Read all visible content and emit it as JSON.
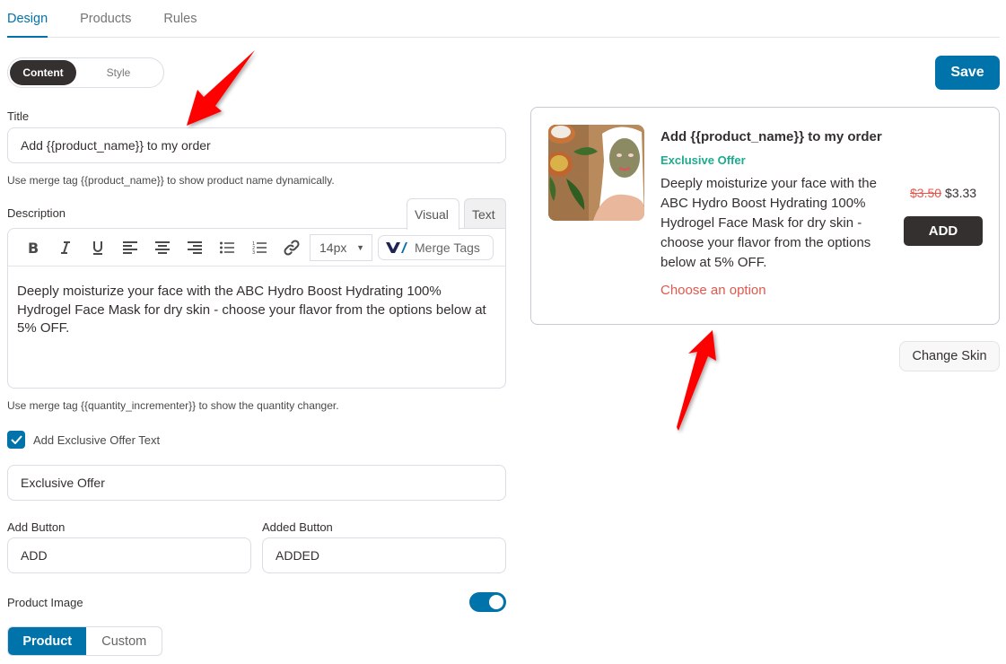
{
  "tabs": [
    {
      "label": "Design",
      "active": true
    },
    {
      "label": "Products",
      "active": false
    },
    {
      "label": "Rules",
      "active": false
    }
  ],
  "mode_toggle": {
    "content": "Content",
    "style": "Style",
    "selected": "Content"
  },
  "save_label": "Save",
  "title_field": {
    "label": "Title",
    "value": "Add {{product_name}} to my order",
    "hint": "Use merge tag {{product_name}} to show product name dynamically."
  },
  "description": {
    "label": "Description",
    "tabs": {
      "visual": "Visual",
      "text": "Text",
      "selected": "Visual"
    },
    "toolbar": {
      "icons": [
        "bold-icon",
        "italic-icon",
        "underline-icon",
        "align-left-icon",
        "align-center-icon",
        "align-right-icon",
        "bullet-list-icon",
        "numbered-list-icon",
        "link-icon"
      ],
      "font_size": "14px",
      "merge_tags_label": "Merge Tags"
    },
    "value": "Deeply moisturize your face with the ABC Hydro Boost Hydrating 100% Hydrogel Face Mask for dry skin - choose your flavor from the options below at 5% OFF.",
    "hint": "Use merge tag {{quantity_incrementer}} to show the quantity changer."
  },
  "exclusive_offer": {
    "checkbox_label": "Add Exclusive Offer Text",
    "checked": true,
    "value": "Exclusive Offer"
  },
  "add_button": {
    "label": "Add Button",
    "value": "ADD"
  },
  "added_button": {
    "label": "Added Button",
    "value": "ADDED"
  },
  "product_image": {
    "label": "Product Image",
    "enabled": true,
    "options": [
      "Product",
      "Custom"
    ],
    "selected": "Product"
  },
  "preview": {
    "title": "Add {{product_name}} to my order",
    "offer": "Exclusive Offer",
    "description": "Deeply moisturize your face with the ABC Hydro Boost Hydrating 100% Hydrogel Face Mask for dry skin - choose your flavor from the options below at 5% OFF.",
    "choose_option": "Choose an option",
    "old_price": "$3.50",
    "new_price": "$3.33",
    "add_label": "ADD"
  },
  "change_skin_label": "Change Skin",
  "colors": {
    "primary": "#0073aa",
    "dark": "#353030",
    "offer_green": "#1daa8d",
    "sale_red": "#e2584d",
    "annotation_arrow": "#ff0000"
  }
}
